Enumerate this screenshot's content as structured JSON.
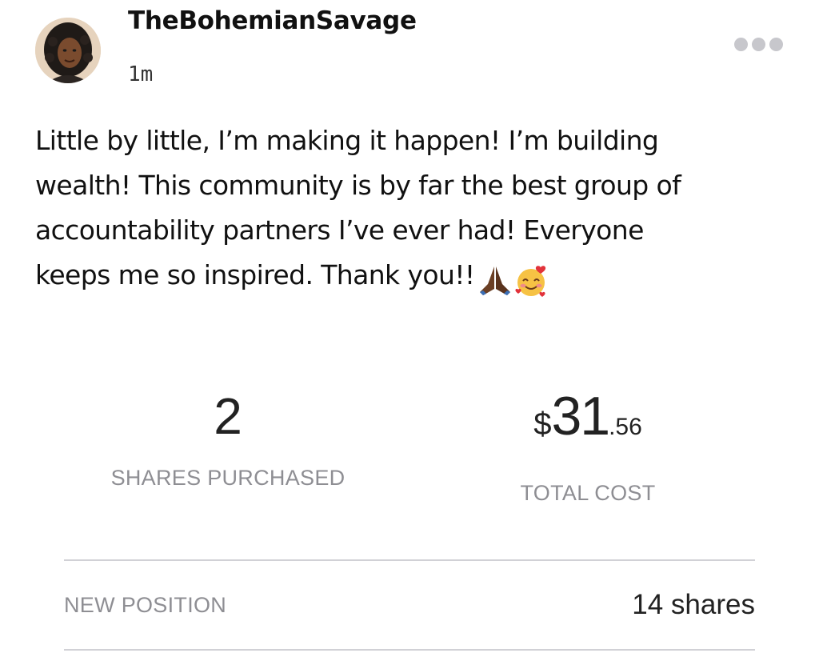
{
  "post": {
    "author": "TheBohemianSavage",
    "time": "1m",
    "text_lines": [
      "Little by little, I’m making it happen! I’m building",
      "wealth! This community is by far the best group of",
      "accountability partners I’ve ever had! Everyone",
      "keeps me so inspired. Thank you!!"
    ],
    "emojis": [
      "praying-hands-icon",
      "smiling-face-with-hearts-icon"
    ],
    "more_icon": "more-dots-icon"
  },
  "trade": {
    "shares_value": "2",
    "shares_label": "SHARES PURCHASED",
    "cost_currency": "$",
    "cost_dollars": "31",
    "cost_cents": ".56",
    "cost_label": "TOTAL COST",
    "position_label": "NEW POSITION",
    "position_value": "14 shares"
  },
  "colors": {
    "text": "#111111",
    "muted": "#8e8e93",
    "divider": "#d1d1d6",
    "dots": "#c7c7cc"
  }
}
